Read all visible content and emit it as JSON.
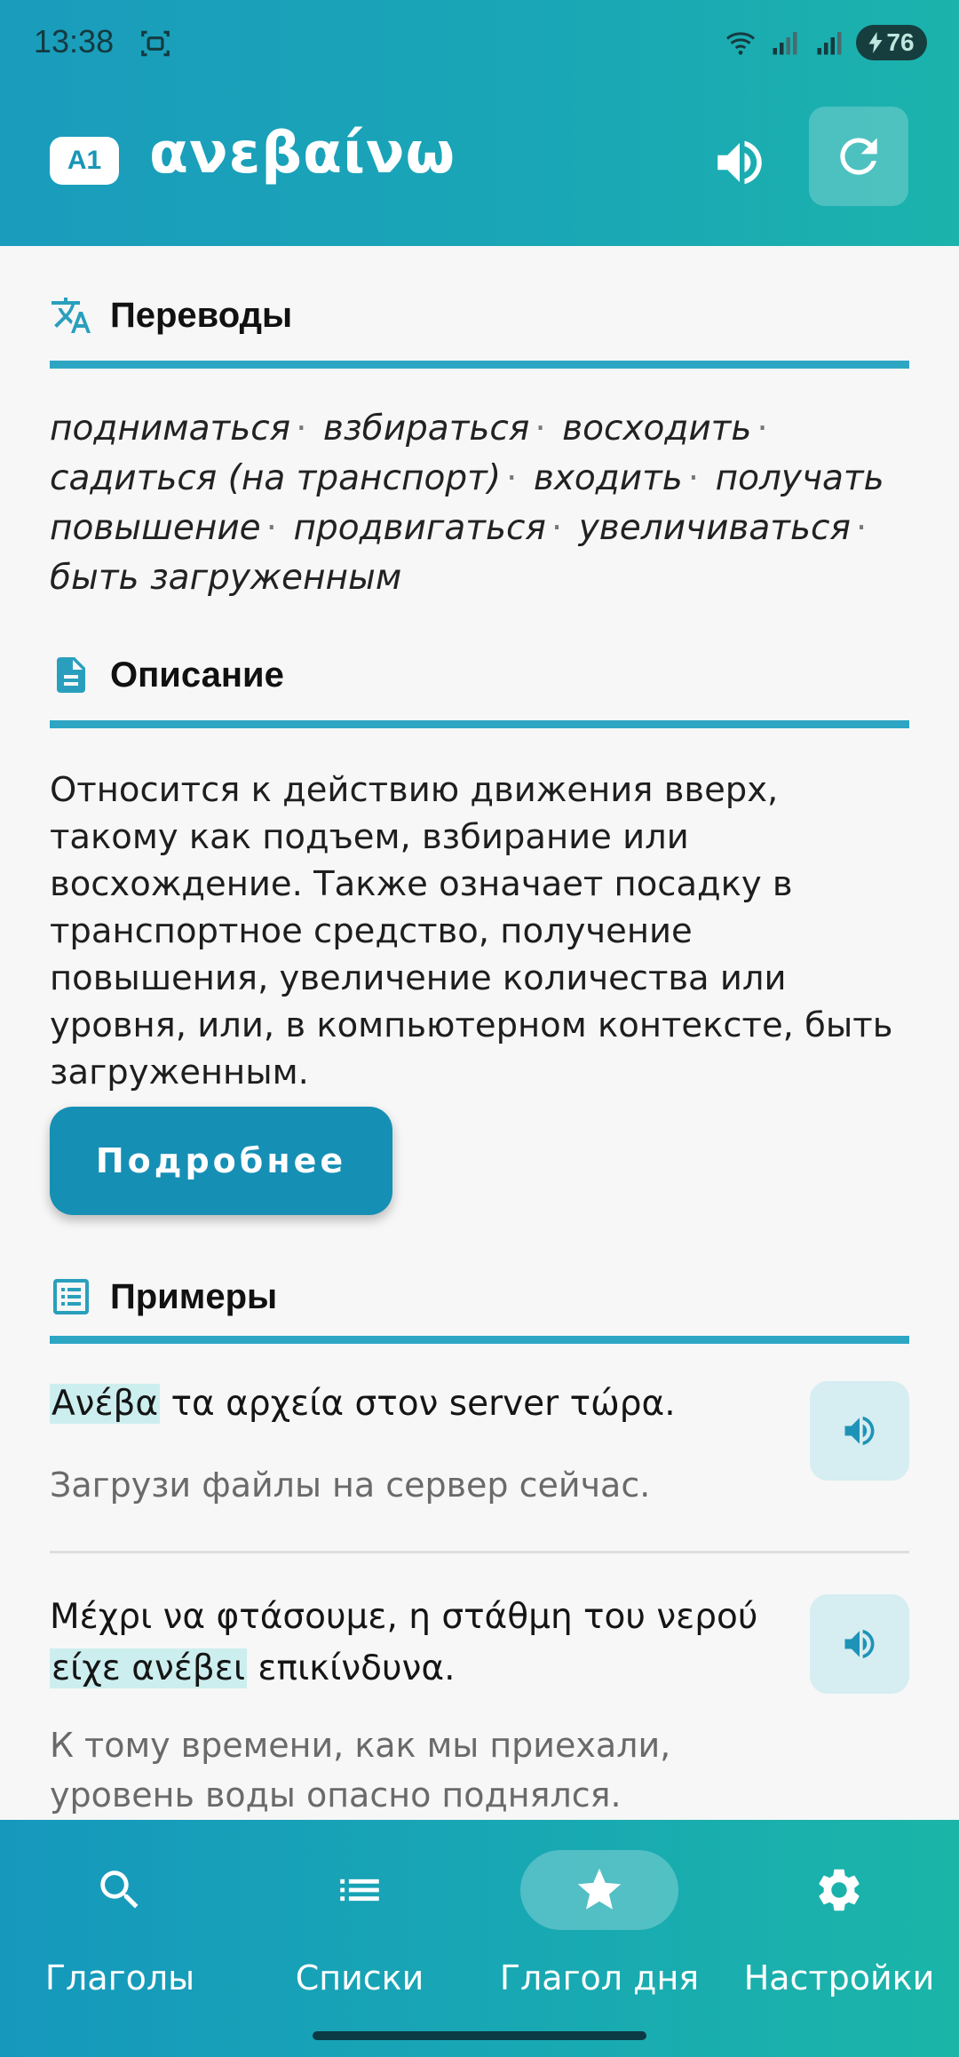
{
  "status": {
    "time": "13:38",
    "battery": "76"
  },
  "header": {
    "level": "A1",
    "verb": "ανεβαίνω"
  },
  "sections": {
    "translations_title": "Переводы",
    "description_title": "Описание",
    "examples_title": "Примеры"
  },
  "translations": [
    "подниматься",
    "взбираться",
    "восходить",
    "садиться (на транспорт)",
    "входить",
    "получать повышение",
    "продвигаться",
    "увеличиваться",
    "быть загруженным"
  ],
  "translation_separator": "·",
  "description": "Относится к действию движения вверх, такому как подъем, взбирание или восхождение. Также означает посадку в транспортное средство, получение повышения, увеличение количества или уровня, или, в компьютерном контексте, быть загруженным.",
  "more_button": "Подробнее",
  "examples": [
    {
      "greek_highlight": "Ανέβα",
      "greek_rest": " τα αρχεία στον server τώρα.",
      "russian": "Загрузи файлы на сервер сейчас."
    },
    {
      "greek_pre": "Μέχρι να φτάσουμε, η στάθμη του νερού ",
      "greek_highlight": "είχε ανέβει",
      "greek_rest": " επικίνδυνα.",
      "russian": "К тому времени, как мы приехали, уровень воды опасно поднялся."
    }
  ],
  "nav": [
    {
      "label": "Глаголы",
      "icon": "search-icon"
    },
    {
      "label": "Списки",
      "icon": "list-icon"
    },
    {
      "label": "Глагол дня",
      "icon": "star-icon",
      "active": true
    },
    {
      "label": "Настройки",
      "icon": "gear-icon"
    }
  ],
  "colors": {
    "accent": "#1a9cbc",
    "rule": "#2da6c4",
    "highlight": "#cdeeee",
    "button": "#168fb5"
  }
}
